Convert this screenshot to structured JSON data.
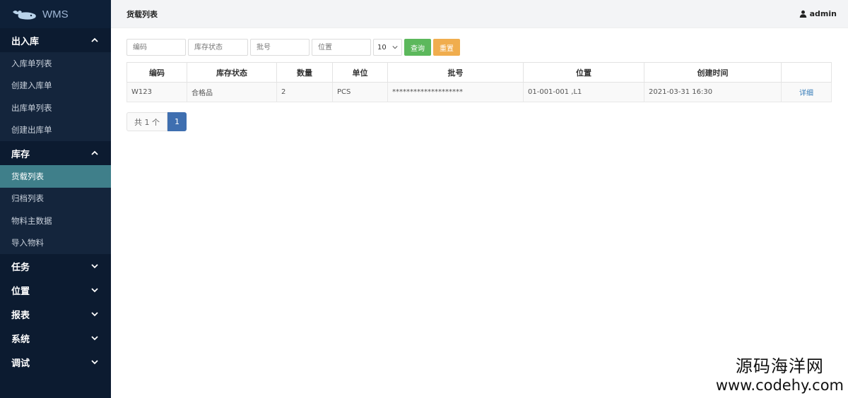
{
  "brand": {
    "name": "WMS",
    "logo_icon": "whale-logo-icon"
  },
  "sidebar": {
    "groups": [
      {
        "label": "出入库",
        "expanded": true,
        "items": [
          "入库单列表",
          "创建入库单",
          "出库单列表",
          "创建出库单"
        ]
      },
      {
        "label": "库存",
        "expanded": true,
        "items": [
          "货载列表",
          "归档列表",
          "物料主数据",
          "导入物料"
        ]
      },
      {
        "label": "任务",
        "expanded": false
      },
      {
        "label": "位置",
        "expanded": false
      },
      {
        "label": "报表",
        "expanded": false
      },
      {
        "label": "系统",
        "expanded": false
      },
      {
        "label": "调试",
        "expanded": false
      }
    ],
    "active_item": "货载列表"
  },
  "header": {
    "title": "货载列表",
    "user": "admin",
    "user_icon": "user-icon"
  },
  "filters": {
    "code_placeholder": "编码",
    "status_placeholder": "库存状态",
    "batch_placeholder": "批号",
    "location_placeholder": "位置",
    "page_size": "10",
    "query_label": "查询",
    "reset_label": "重置"
  },
  "table": {
    "columns": [
      "编码",
      "库存状态",
      "数量",
      "单位",
      "批号",
      "位置",
      "创建时间",
      ""
    ],
    "rows": [
      [
        "W123",
        "合格品",
        "2",
        "PCS",
        "********************",
        "01-001-001 ,L1",
        "2021-03-31 16:30",
        "详细"
      ]
    ]
  },
  "pager": {
    "total": "共 1 个",
    "current": "1"
  },
  "watermark": {
    "cn": "源码海洋网",
    "url": "www.codehy.com"
  },
  "colors": {
    "sidebar_bg": "#0c1b30",
    "active_bg": "#3f7f8a",
    "query": "#5cb85c",
    "reset": "#f0ad4e",
    "pager_active": "#3f6fb0"
  }
}
